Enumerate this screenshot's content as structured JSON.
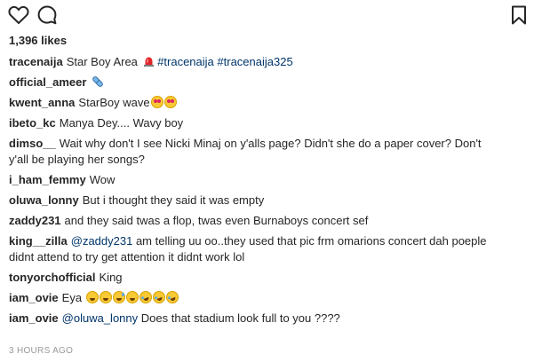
{
  "actions": {
    "like_icon": "heart-outline-icon",
    "comment_icon": "speech-bubble-icon",
    "save_icon": "bookmark-outline-icon"
  },
  "likes_text": "1,396 likes",
  "caption": {
    "user": "tracenaija",
    "text": "Star Boy Area",
    "tags": [
      "#tracenaija",
      "#tracenaija325"
    ]
  },
  "comments": [
    {
      "user": "official_ameer",
      "text": ""
    },
    {
      "user": "kwent_anna",
      "text": "StarBoy wave"
    },
    {
      "user": "ibeto_kc",
      "text": "Manya Dey.... Wavy boy"
    },
    {
      "user": "dimso__",
      "text": "Wait why don't I see Nicki Minaj on y'alls page? Didn't she do a paper cover? Don't",
      "text2": "y'all be playing her songs?"
    },
    {
      "user": "i_ham_femmy",
      "text": "Wow"
    },
    {
      "user": "oluwa_lonny",
      "text": "But i thought they said it was empty"
    },
    {
      "user": "zaddy231",
      "text": "and they said twas a flop, twas even Burnaboys concert sef"
    },
    {
      "user": "king__zilla",
      "mention": "@zaddy231",
      "text": "am telling uu oo..they used that pic frm omarions concert dah poeple",
      "text2": "didnt attend to try get attention it didnt work lol"
    },
    {
      "user": "tonyorchofficial",
      "text": "King"
    },
    {
      "user": "iam_ovie",
      "text": "Eya"
    },
    {
      "user": "iam_ovie",
      "mention": "@oluwa_lonny",
      "text": "Does that stadium look full to you ????"
    }
  ],
  "timestamp": "3 HOURS AGO",
  "colors": {
    "text": "#262626",
    "link": "#003569",
    "muted": "#999999"
  }
}
